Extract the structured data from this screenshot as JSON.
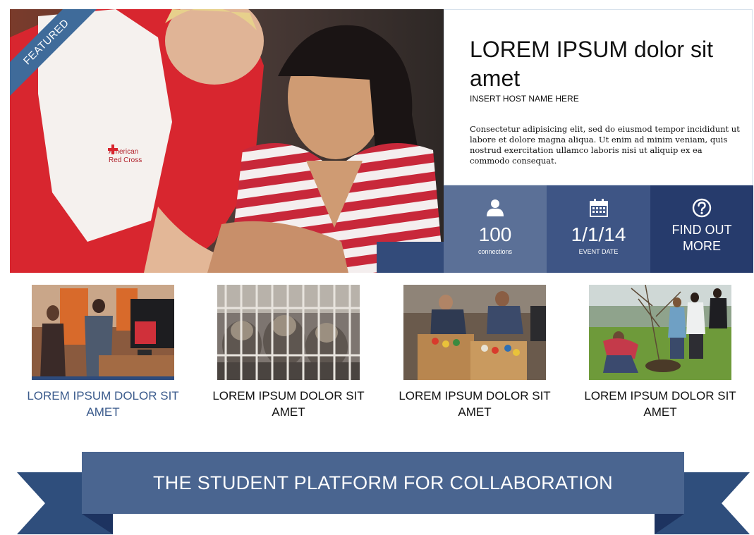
{
  "hero": {
    "ribbon_label": "FEATURED",
    "title": "LOREM IPSUM dolor sit amet",
    "host": "INSERT HOST NAME HERE",
    "description": "Consectetur adipisicing elit, sed do eiusmod tempor incididunt ut labore et dolore magna aliqua. Ut enim ad minim veniam, quis nostrud exercitation ullamco laboris nisi ut aliquip ex ea commodo consequat."
  },
  "stats": {
    "connections": {
      "value": "100",
      "label": "connections",
      "icon": "person-icon"
    },
    "event_date": {
      "value": "1/1/14",
      "label": "EVENT DATE",
      "icon": "calendar-icon"
    },
    "cta": {
      "label": "FIND OUT MORE",
      "icon": "question-icon"
    }
  },
  "cards": [
    {
      "caption": "LOREM IPSUM DOLOR SIT AMET",
      "image": "office-photo"
    },
    {
      "caption": "LOREM IPSUM DOLOR SIT AMET",
      "image": "kittens-photo"
    },
    {
      "caption": "LOREM IPSUM DOLOR SIT AMET",
      "image": "food-drive-photo"
    },
    {
      "caption": "LOREM IPSUM DOLOR SIT AMET",
      "image": "tree-planting-photo"
    }
  ],
  "banner": {
    "text": "THE STUDENT PLATFORM FOR COLLABORATION"
  },
  "colors": {
    "ribbon": "#3f6b9a",
    "tile_light": "#5b7097",
    "tile_mid": "#3e5585",
    "tile_dark": "#263b6c",
    "banner": "#4a6590",
    "banner_tail": "#2f4e7c",
    "active_caption": "#3b5b8c"
  }
}
